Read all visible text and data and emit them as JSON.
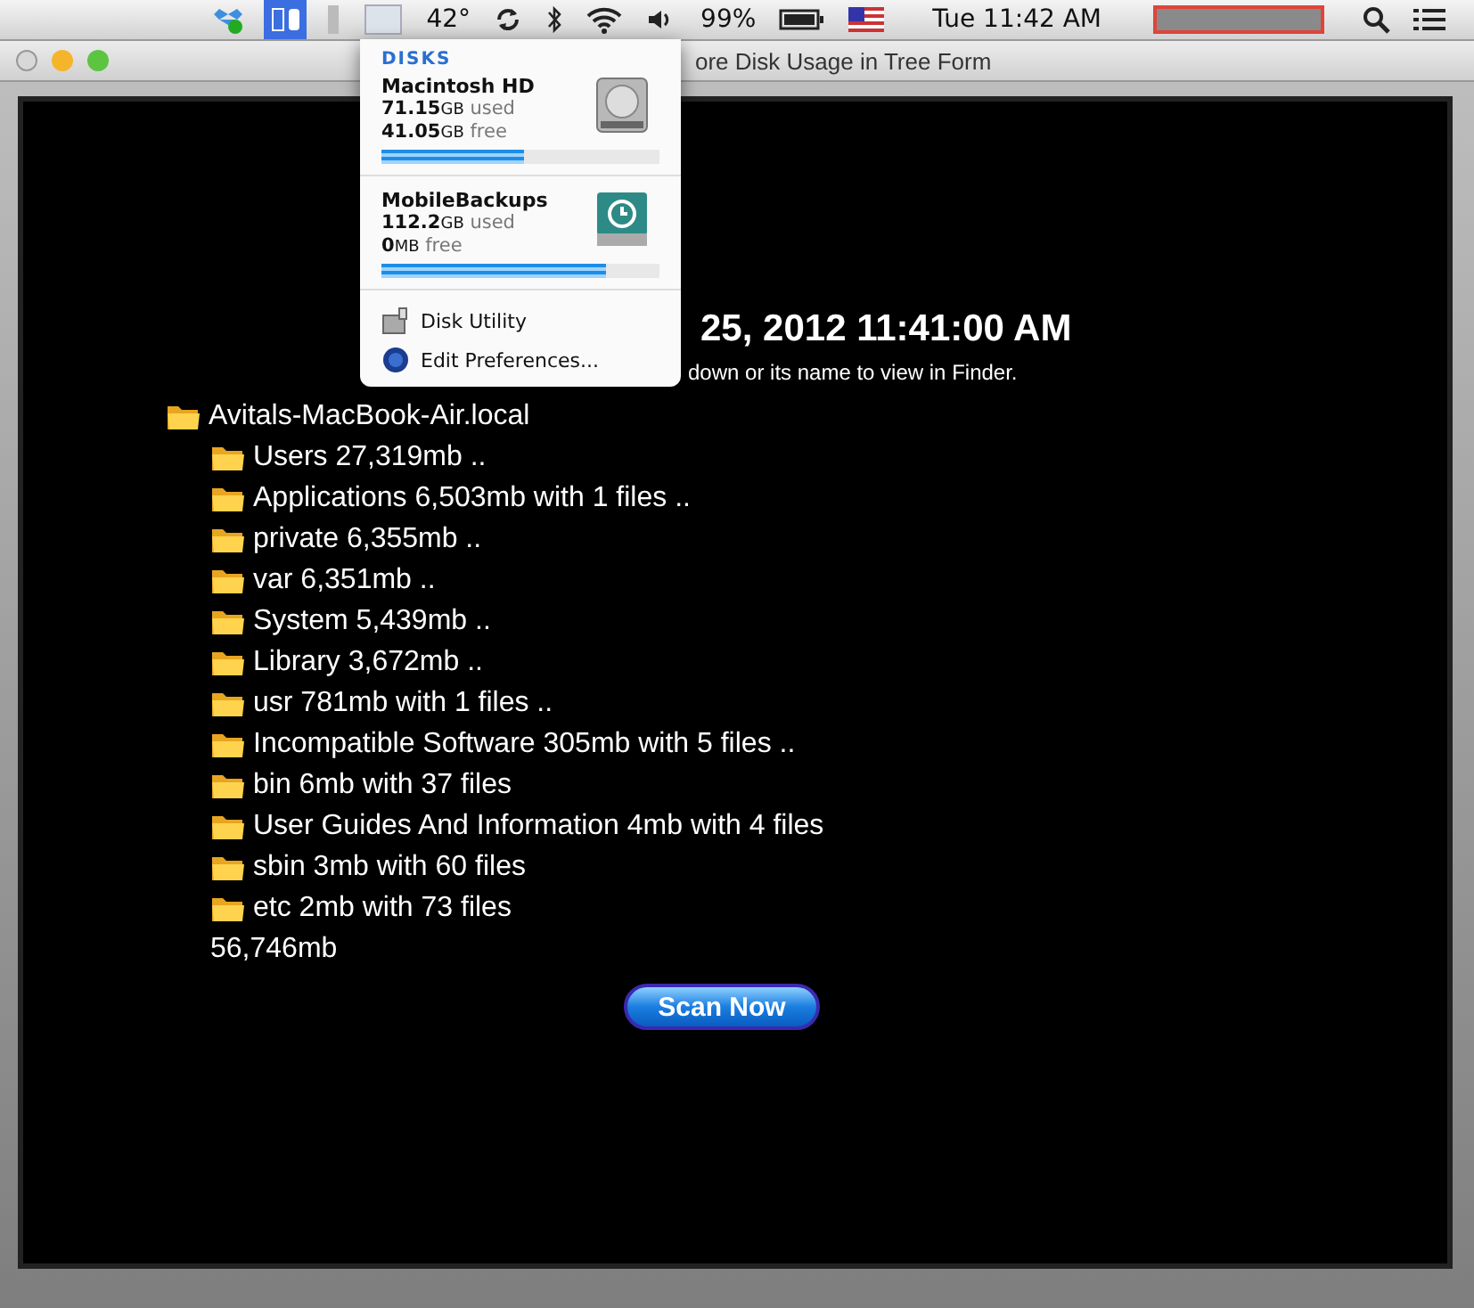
{
  "menu_bar": {
    "items": [
      {
        "kind": "dropbox",
        "selected": false
      },
      {
        "kind": "hd",
        "selected": true
      },
      {
        "kind": "cpu",
        "selected": false
      },
      {
        "kind": "display",
        "selected": false
      },
      {
        "kind": "temp",
        "text": "42°",
        "selected": false
      },
      {
        "kind": "sync",
        "selected": false
      },
      {
        "kind": "bluetooth",
        "selected": false
      },
      {
        "kind": "wifi",
        "selected": false
      },
      {
        "kind": "volume",
        "selected": false
      },
      {
        "kind": "battery",
        "text": "99%",
        "selected": false
      },
      {
        "kind": "flag",
        "selected": false
      },
      {
        "kind": "clock",
        "text": "Tue 11:42 AM",
        "selected": false
      },
      {
        "kind": "redacted",
        "selected": false
      },
      {
        "kind": "search",
        "selected": false
      },
      {
        "kind": "list",
        "selected": false
      }
    ]
  },
  "window": {
    "title": "ore Disk Usage in Tree Form"
  },
  "header": {
    "scan_date": "25, 2012 11:41:00 AM",
    "hint": "down or its name to view in Finder."
  },
  "tree": {
    "label": "Avitals-MacBook-Air.local",
    "children": [
      {
        "label": "Users 27,319mb .."
      },
      {
        "label": "Applications 6,503mb with 1 files .."
      },
      {
        "label": "private 6,355mb .."
      },
      {
        "label": "var 6,351mb .."
      },
      {
        "label": "System 5,439mb .."
      },
      {
        "label": "Library 3,672mb .."
      },
      {
        "label": "usr 781mb with 1 files .."
      },
      {
        "label": "Incompatible Software 305mb with 5 files .."
      },
      {
        "label": "bin 6mb with 37 files"
      },
      {
        "label": "User Guides And Information 4mb with 4 files"
      },
      {
        "label": "sbin 3mb with 60 files"
      },
      {
        "label": "etc 2mb with 73 files"
      }
    ],
    "total": "56,746mb"
  },
  "scan_button": "Scan Now",
  "disks_menu": {
    "heading": "DISKS",
    "disks": [
      {
        "kind": "hard-drive",
        "name": "Macintosh HD",
        "used": "71.15",
        "used_unit": "GB",
        "used_label": "used",
        "free": "41.05",
        "free_unit": "GB",
        "free_label": "free",
        "level": 0.51
      },
      {
        "kind": "backup",
        "name": "MobileBackups",
        "used": "112.2",
        "used_unit": "GB",
        "used_label": "used",
        "free": "0",
        "free_unit": "MB",
        "free_label": "free",
        "level": 0.81
      }
    ],
    "actions": [
      {
        "kind": "utility",
        "label": "Disk Utility"
      },
      {
        "kind": "prefs",
        "label": "Edit Preferences..."
      }
    ]
  }
}
